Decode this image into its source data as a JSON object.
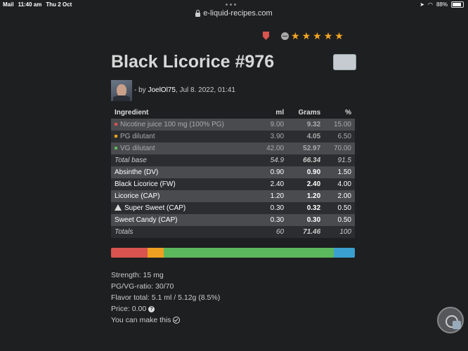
{
  "status": {
    "left": [
      "Mail",
      "11:40 am",
      "Thu 2 Oct"
    ],
    "battery": "88%"
  },
  "browser": {
    "url": "e-liquid-recipes.com"
  },
  "recipe": {
    "title": "Black Licorice #976",
    "byline_prefix": "- by",
    "author": "JoelOl75",
    "date": ", Jul 8. 2022, 01:41",
    "rating_stars": 5
  },
  "table": {
    "headers": [
      "Ingredient",
      "ml",
      "Grams",
      "%"
    ],
    "base": [
      {
        "name": "Nicotine juice 100 mg (100% PG)",
        "ml": "9.00",
        "grams": "9.32",
        "pct": "15.00",
        "dot_color": "#d9534f"
      },
      {
        "name": "PG dilutant",
        "ml": "3.90",
        "grams": "4.05",
        "pct": "6.50",
        "dot_color": "#f0a020"
      },
      {
        "name": "VG dilutant",
        "ml": "42.00",
        "grams": "52.97",
        "pct": "70.00",
        "dot_color": "#5cb85c"
      }
    ],
    "base_total": {
      "name": "Total base",
      "ml": "54.9",
      "grams": "66.34",
      "pct": "91.5"
    },
    "flavors": [
      {
        "name": "Absinthe (DV)",
        "ml": "0.90",
        "grams": "0.90",
        "pct": "1.50"
      },
      {
        "name": "Black Licorice (FW)",
        "ml": "2.40",
        "grams": "2.40",
        "pct": "4.00"
      },
      {
        "name": "Licorice (CAP)",
        "ml": "1.20",
        "grams": "1.20",
        "pct": "2.00"
      },
      {
        "name": "Super Sweet (CAP)",
        "ml": "0.30",
        "grams": "0.32",
        "pct": "0.50",
        "warning": true
      },
      {
        "name": "Sweet Candy (CAP)",
        "ml": "0.30",
        "grams": "0.30",
        "pct": "0.50"
      }
    ],
    "totals": {
      "name": "Totals",
      "ml": "60",
      "grams": "71.46",
      "pct": "100"
    }
  },
  "composition_bar": [
    {
      "label": "nicotine",
      "pct": 15,
      "color": "#d9534f"
    },
    {
      "label": "pg",
      "pct": 6.5,
      "color": "#f0a020"
    },
    {
      "label": "vg",
      "pct": 70,
      "color": "#5cb85c"
    },
    {
      "label": "flavor",
      "pct": 8.5,
      "color": "#3aa0d0"
    }
  ],
  "info": {
    "strength": "Strength: 15 mg",
    "ratio": "PG/VG-ratio: 30/70",
    "flavor_total": "Flavor total: 5.1 ml / 5.12g (8.5%)",
    "price": "Price: 0.00",
    "can_make": "You can make this"
  },
  "icons": [
    "lock-icon",
    "flag-icon",
    "minus-circle-icon",
    "star-icon",
    "warning-icon",
    "help-icon",
    "check-circle-icon",
    "navigation-icon"
  ]
}
